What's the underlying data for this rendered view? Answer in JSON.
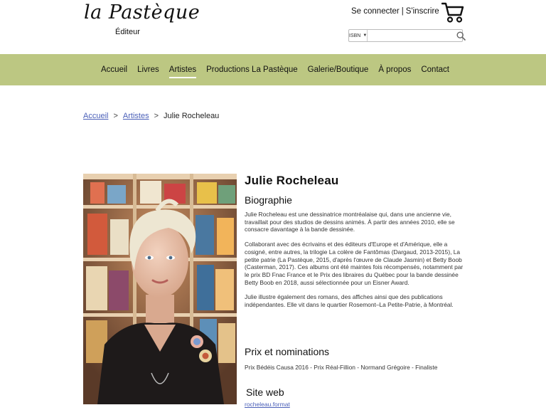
{
  "header": {
    "logo_text": "la Pastèque",
    "logo_sub": "Éditeur",
    "login_label": "Se connecter",
    "separator": "|",
    "signup_label": "S'inscrire",
    "cart_icon": "shopping-cart-icon",
    "search": {
      "type_label": "ISBN",
      "value": "",
      "placeholder": "",
      "button_icon": "search-icon"
    }
  },
  "nav": {
    "items": [
      {
        "label": "Accueil"
      },
      {
        "label": "Livres"
      },
      {
        "label": "Artistes"
      },
      {
        "label": "Productions La Pastèque"
      },
      {
        "label": "Galerie/Boutique"
      },
      {
        "label": "À propos"
      },
      {
        "label": "Contact"
      }
    ],
    "active_index": 2,
    "background": "#bcc782"
  },
  "breadcrumb": {
    "items": [
      "Accueil",
      "Artistes",
      "Julie Rocheleau"
    ],
    "separator": ">"
  },
  "artist": {
    "name": "Julie Rocheleau",
    "bio_title": "Biographie",
    "bio_paragraphs": [
      "Julie Rocheleau est une dessinatrice montréalaise qui, dans une ancienne vie, travaillait pour des studios de dessins animés. À partir des années 2010, elle se consacre davantage à la bande dessinée.",
      "Collaborant avec des écrivains et des éditeurs d'Europe et d'Amérique, elle a cosigné, entre autres, la trilogie La colère de Fantômas (Dargaud, 2013-2015), La petite patrie (La Pastèque, 2015, d'après l'œuvre de Claude Jasmin) et Betty Boob (Casterman, 2017). Ces albums ont été maintes fois récompensés, notamment par le prix BD Fnac France et le Prix des libraires du Québec pour la bande dessinée Betty Boob en 2018, aussi sélectionnée pour un Eisner Award.",
      "Julie illustre également des romans, des affiches ainsi que des publications indépendantes. Elle vit dans le quartier Rosemont–La Petite-Patrie, à Montréal."
    ],
    "prix_title": "Prix et nominations",
    "prix_items": [
      "Prix Bédéis Causa 2016 - Prix Réal-Fillion - Normand Grégoire - Finaliste"
    ],
    "site_title": "Site web",
    "site_link": "rocheleau.format"
  },
  "colors": {
    "link": "#4a5fb8",
    "nav_bg": "#bcc782"
  }
}
